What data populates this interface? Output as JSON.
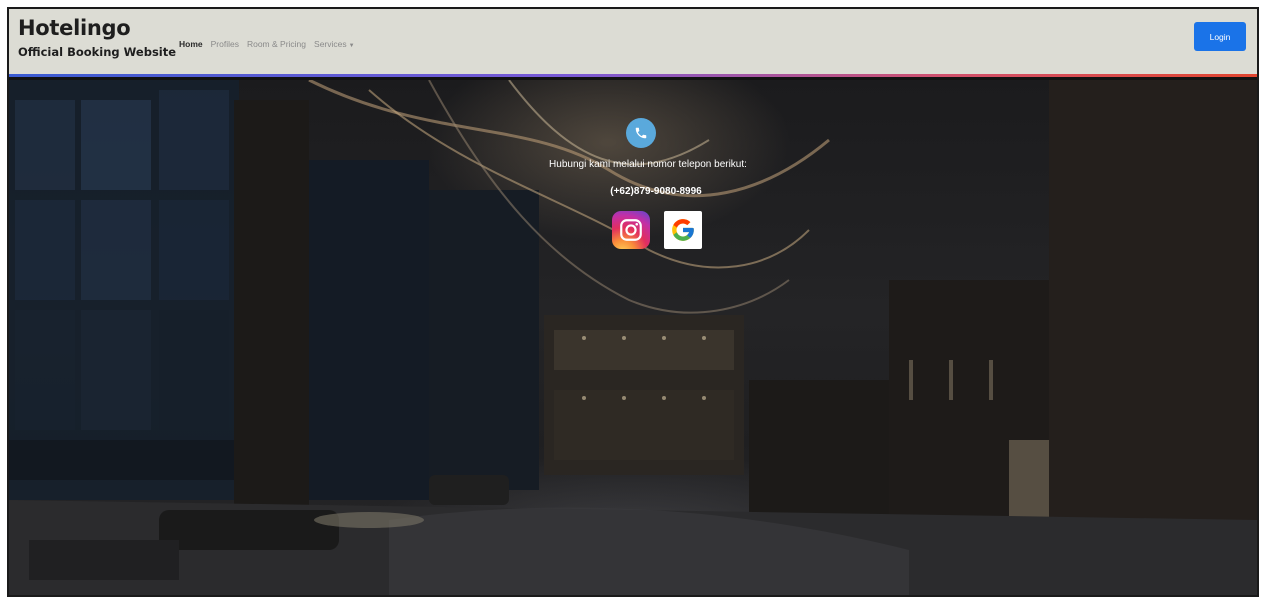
{
  "brand": {
    "title": "Hotelingo",
    "subtitle": "Official Booking Website"
  },
  "nav": {
    "items": [
      {
        "label": "Home",
        "active": true
      },
      {
        "label": "Profiles",
        "active": false
      },
      {
        "label": "Room & Pricing",
        "active": false
      },
      {
        "label": "Services",
        "active": false,
        "dropdown": true
      }
    ],
    "login_label": "Login"
  },
  "contact": {
    "icon": "phone-icon",
    "text": "Hubungi kami melalui nomor telepon berikut:",
    "phone": "(+62)879-9080-8996",
    "socials": [
      {
        "name": "instagram-icon"
      },
      {
        "name": "google-icon"
      }
    ]
  },
  "colors": {
    "navbar_bg": "#dcdcd4",
    "accent": "#1a73e8",
    "phone_icon_bg": "#5aa9dc"
  }
}
